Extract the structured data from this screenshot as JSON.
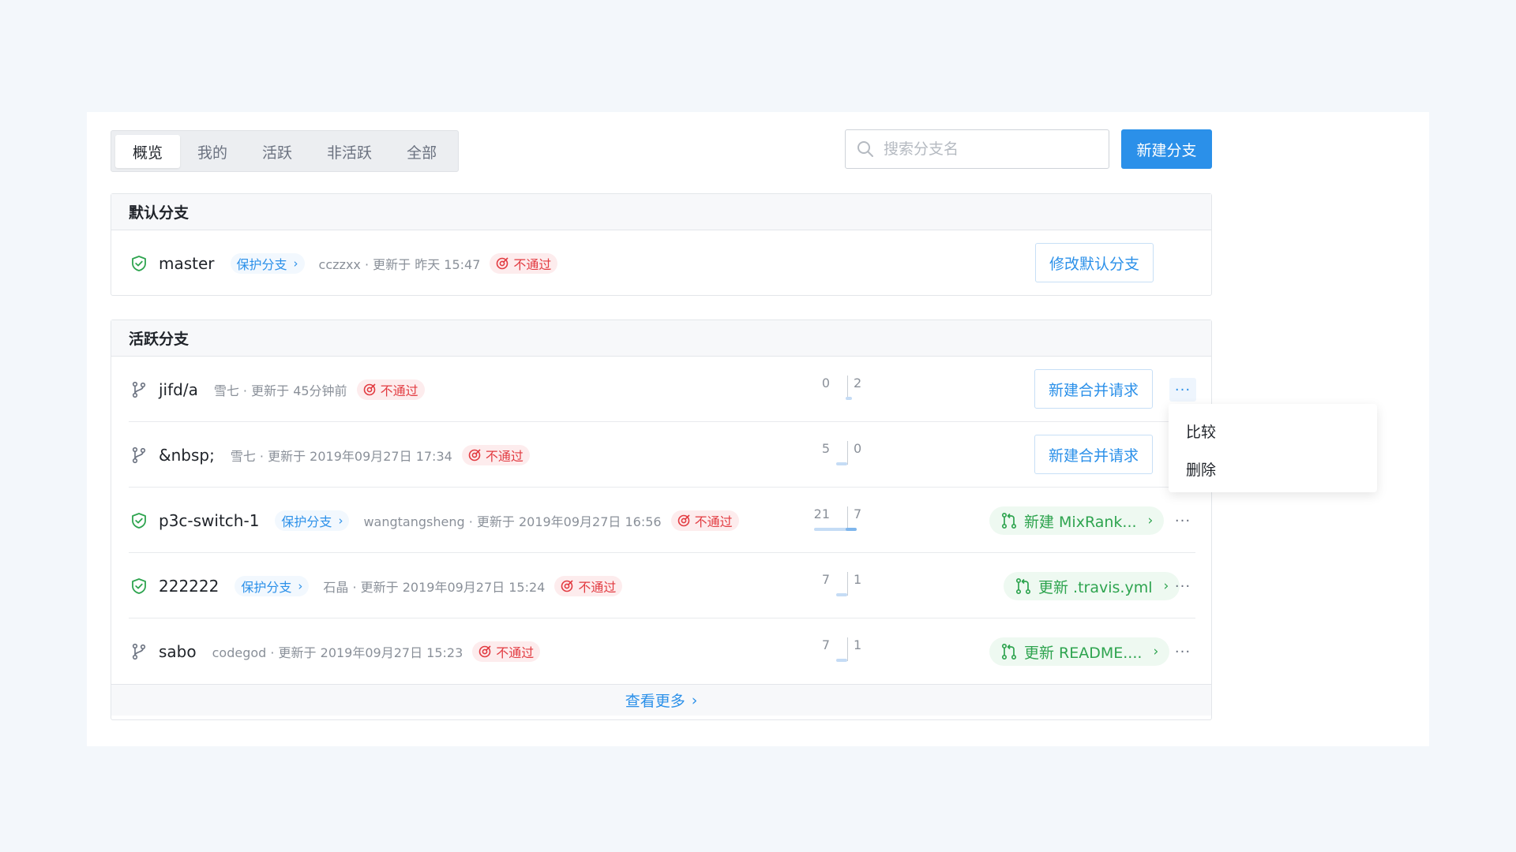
{
  "tabs": [
    "概览",
    "我的",
    "活跃",
    "非活跃",
    "全部"
  ],
  "search": {
    "placeholder": "搜索分支名"
  },
  "new_branch_label": "新建分支",
  "default_section": {
    "title": "默认分支",
    "branch": {
      "name": "master",
      "protect_label": "保护分支",
      "meta": "cczzxx · 更新于 昨天 15:47",
      "status": "不通过",
      "action": "修改默认分支"
    }
  },
  "active_section": {
    "title": "活跃分支",
    "branches": [
      {
        "name": "jifd/a",
        "meta": "雪七 · 更新于 45分钟前",
        "status": "不通过",
        "behind": "0",
        "ahead": "2",
        "action": "新建合并请求"
      },
      {
        "name": "&nbsp;",
        "meta": "雪七 · 更新于 2019年09月27日 17:34",
        "status": "不通过",
        "behind": "5",
        "ahead": "0",
        "action": "新建合并请求"
      },
      {
        "name": "p3c-switch-1",
        "protect_label": "保护分支",
        "meta": "wangtangsheng · 更新于 2019年09月27日 16:56",
        "status": "不通过",
        "behind": "21",
        "ahead": "7",
        "mr": "新建 MixRank..."
      },
      {
        "name": "222222",
        "protect_label": "保护分支",
        "meta": "石晶 · 更新于 2019年09月27日 15:24",
        "status": "不通过",
        "behind": "7",
        "ahead": "1",
        "mr": "更新 .travis.yml"
      },
      {
        "name": "sabo",
        "meta": "codegod · 更新于 2019年09月27日 15:23",
        "status": "不通过",
        "behind": "7",
        "ahead": "1",
        "mr": "更新 README...."
      }
    ],
    "view_more": "查看更多"
  },
  "menu": {
    "compare": "比较",
    "delete": "删除"
  },
  "colors": {
    "primary": "#2b90e9",
    "danger": "#e23b41",
    "success": "#2ea44f"
  },
  "icons": {
    "protected": "shield-check-icon",
    "branch": "git-branch-icon",
    "fail": "fail-status-icon",
    "merge_request": "merge-request-icon",
    "more": "more-dots-icon",
    "search": "search-icon"
  }
}
